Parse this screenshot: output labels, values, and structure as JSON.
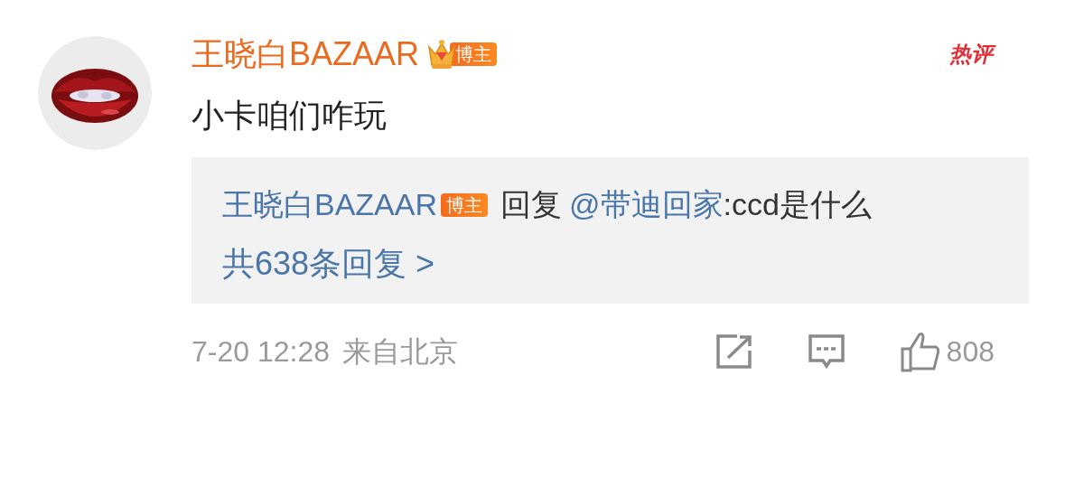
{
  "comment": {
    "author": "王晓白BAZAAR",
    "author_badge": "博主",
    "hot_label": "热评",
    "text": "小卡咱们咋玩",
    "reply": {
      "author": "王晓白BAZAAR",
      "author_badge": "博主",
      "verb": "回复",
      "mention": "@带迪回家",
      "text": ":ccd是什么"
    },
    "reply_count_link": "共638条回复 >",
    "time": "7-20 12:28",
    "location": "来自北京",
    "likes": "808"
  }
}
